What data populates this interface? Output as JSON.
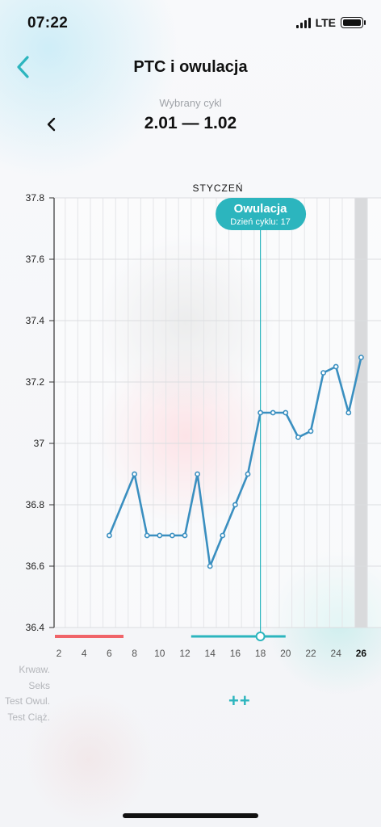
{
  "status": {
    "time": "07:22",
    "network": "LTE"
  },
  "header": {
    "title": "PTC i owulacja",
    "back_icon": "chevron-left-icon"
  },
  "cycle": {
    "label": "Wybrany cykl",
    "range": "2.01 — 1.02",
    "prev_icon": "chevron-left-icon"
  },
  "chart": {
    "month": "STYCZEŃ"
  },
  "chart_data": {
    "type": "line",
    "title": "",
    "xlabel": "",
    "ylabel": "",
    "ylim": [
      36.4,
      37.8
    ],
    "y_ticks": [
      "36.4",
      "36.6",
      "36.8",
      "37",
      "37.2",
      "37.4",
      "37.6",
      "37.8"
    ],
    "x_ticks": [
      "2",
      "4",
      "6",
      "8",
      "10",
      "12",
      "14",
      "16",
      "18",
      "20",
      "22",
      "24",
      "26"
    ],
    "highlight_tick": "26",
    "x": [
      6,
      8,
      9,
      10,
      11,
      12,
      13,
      14,
      15,
      16,
      17,
      18,
      19,
      20,
      21,
      22,
      23,
      24,
      25,
      26
    ],
    "y": [
      36.7,
      36.9,
      36.7,
      36.7,
      36.7,
      36.7,
      36.9,
      36.6,
      36.7,
      36.8,
      36.9,
      37.1,
      37.1,
      37.1,
      37.02,
      37.04,
      37.23,
      37.25,
      37.1,
      37.28
    ],
    "line_color": "#3a8fc0",
    "ovulation_day": 18,
    "ovulation": {
      "title": "Owulacja",
      "subtitle": "Dzień cyklu: 17",
      "color": "#2cb5be"
    },
    "period_bar": {
      "start": 2,
      "end": 7,
      "color": "#f06469"
    },
    "fertile_bar": {
      "start": 12.5,
      "end": 20,
      "color": "#2cb5be"
    },
    "today_day": 26
  },
  "rows": [
    "Krwaw.",
    "Seks",
    "Test Owul.",
    "Test Ciąż."
  ],
  "add_label": "++"
}
